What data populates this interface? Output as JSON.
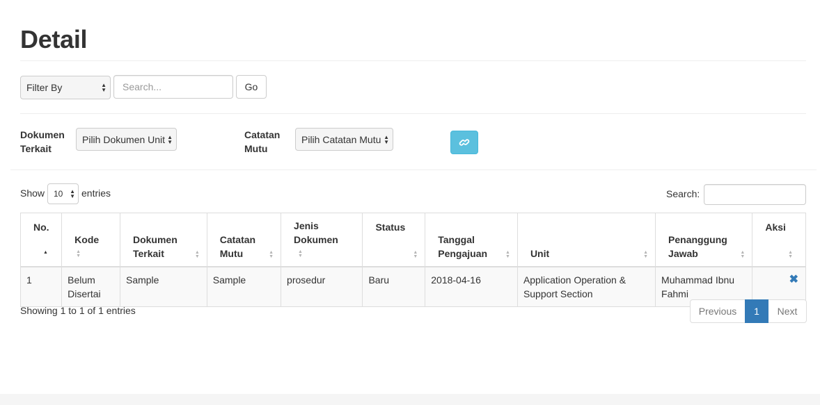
{
  "page": {
    "title": "Detail"
  },
  "filter": {
    "filter_by": "Filter By",
    "search_placeholder": "Search...",
    "go_label": "Go"
  },
  "link_form": {
    "dokumen_label_line1": "Dokumen",
    "dokumen_label_line2": "Terkait",
    "dokumen_select": "Pilih Dokumen Unit",
    "catatan_label_line1": "Catatan",
    "catatan_label_line2": "Mutu",
    "catatan_select": "Pilih Catatan Mutu",
    "link_icon": "link-icon",
    "link_button_color": "#5bc0de"
  },
  "table_controls": {
    "show_label": "Show",
    "entries_value": "10",
    "entries_label": "entries",
    "search_label": "Search:"
  },
  "table": {
    "columns": [
      {
        "line1": "No.",
        "line2": ""
      },
      {
        "line1": "Kode",
        "line2": ""
      },
      {
        "line1": "Dokumen",
        "line2": "Terkait"
      },
      {
        "line1": "Catatan",
        "line2": "Mutu"
      },
      {
        "line1": "Jenis",
        "line2": "Dokumen"
      },
      {
        "line1": "Status",
        "line2": ""
      },
      {
        "line1": "Tanggal",
        "line2": "Pengajuan"
      },
      {
        "line1": "Unit",
        "line2": ""
      },
      {
        "line1": "Penanggung",
        "line2": "Jawab"
      },
      {
        "line1": "Aksi",
        "line2": ""
      }
    ],
    "rows": [
      {
        "no": "1",
        "kode_line1": "Belum",
        "kode_line2": "Disertai",
        "dokumen": "Sample",
        "catatan": "Sample",
        "jenis": "prosedur",
        "status": "Baru",
        "tanggal": "2018-04-16",
        "unit_line1": "Application Operation &",
        "unit_line2": "Support Section",
        "pj_line1": "Muhammad Ibnu",
        "pj_line2": "Fahmi",
        "aksi": "✖"
      }
    ]
  },
  "footer": {
    "info": "Showing 1 to 1 of 1 entries",
    "previous": "Previous",
    "page_1": "1",
    "next": "Next",
    "active_color": "#337ab7"
  }
}
